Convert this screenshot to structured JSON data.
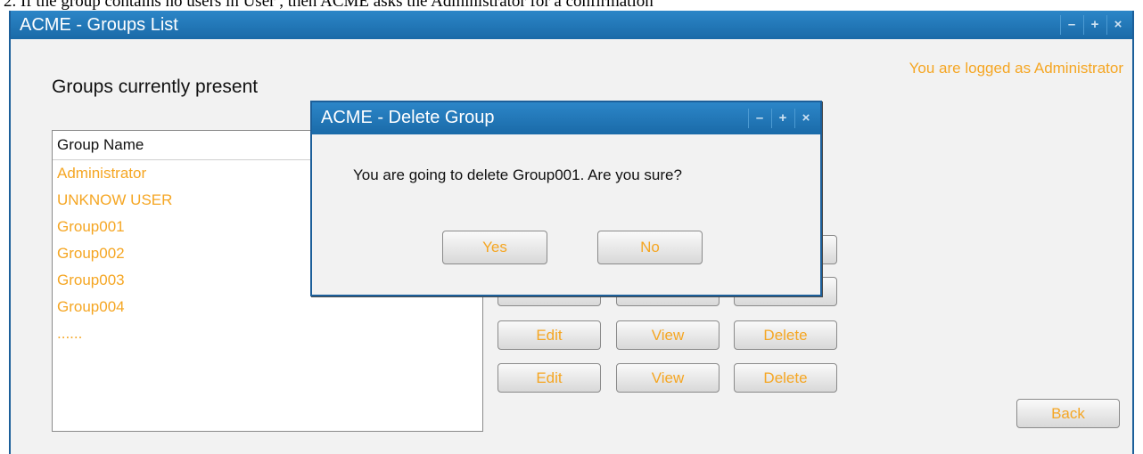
{
  "caption": "2. If the group contains no users in User , then ACME asks the Administrator for a confirmation",
  "window": {
    "title": "ACME - Groups List",
    "controls": {
      "minimize": "–",
      "maximize": "+",
      "close": "×"
    },
    "logged_text": "You are logged as Administrator",
    "groups_heading": "Groups currently present",
    "list": {
      "header": "Group Name",
      "items": [
        "Administrator",
        "UNKNOW USER",
        "Group001",
        "Group002",
        "Group003",
        "Group004",
        "......"
      ]
    },
    "row_buttons": {
      "edit": "Edit",
      "view": "View",
      "delete": "Delete"
    },
    "back_label": "Back"
  },
  "dialog": {
    "title": "ACME - Delete Group",
    "message": "You are going to delete Group001. Are you sure?",
    "yes_label": "Yes",
    "no_label": "No"
  },
  "colors": {
    "accent": "#f5a623",
    "titlebar": "#1f72b4",
    "panel": "#f2f2f2"
  }
}
